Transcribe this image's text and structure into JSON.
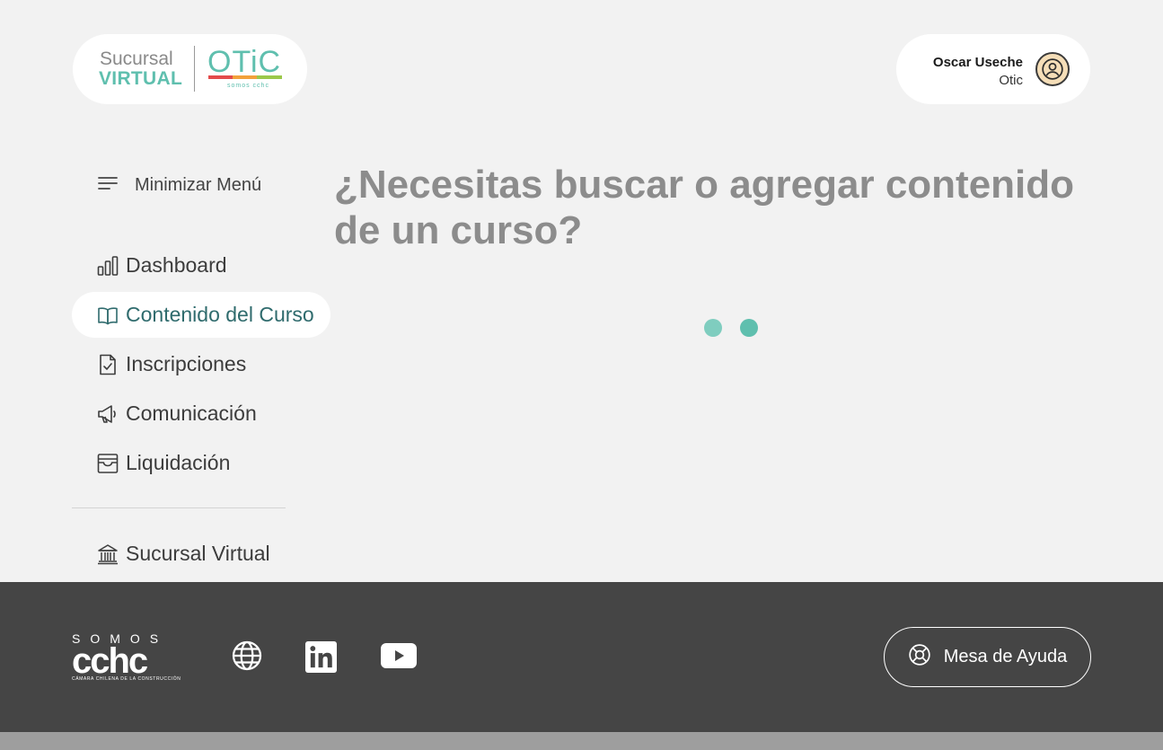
{
  "header": {
    "logo": {
      "line1": "Sucursal",
      "line2": "VIRTUAL",
      "brand": "OTiC",
      "brand_sub": "somos cchc"
    },
    "user": {
      "name": "Oscar Useche",
      "role": "Otic",
      "avatar_icon": "user-circle-icon"
    }
  },
  "sidebar": {
    "toggle_label": "Minimizar Menú",
    "items": [
      {
        "label": "Dashboard",
        "icon": "bar-chart-icon",
        "active": false
      },
      {
        "label": "Contenido del Curso",
        "icon": "book-open-icon",
        "active": true
      },
      {
        "label": "Inscripciones",
        "icon": "file-check-icon",
        "active": false
      },
      {
        "label": "Comunicación",
        "icon": "megaphone-icon",
        "active": false
      },
      {
        "label": "Liquidación",
        "icon": "archive-icon",
        "active": false
      }
    ],
    "extra_item": {
      "label": "Sucursal Virtual",
      "icon": "bank-icon"
    }
  },
  "main": {
    "heading": "¿Necesitas buscar o agregar contenido de un curso?",
    "loading": true
  },
  "footer": {
    "brand_top": "SOMOS",
    "brand_mark": "cchc",
    "brand_sub": "CÁMARA CHILENA DE LA CONSTRUCCIÓN",
    "social": [
      "globe-icon",
      "linkedin-icon",
      "youtube-icon"
    ],
    "help_label": "Mesa de Ayuda"
  },
  "colors": {
    "accent": "#5fbfae",
    "active_text": "#2f6b6d",
    "footer_bg": "#454545",
    "page_bg": "#f2f2f2"
  }
}
